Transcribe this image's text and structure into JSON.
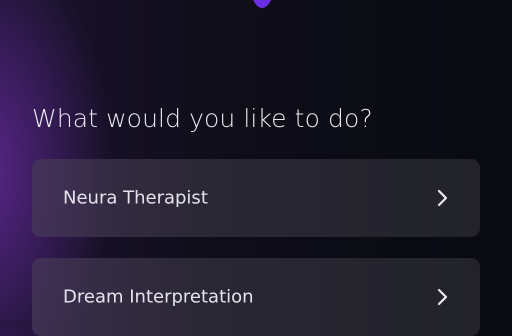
{
  "logo": {
    "icon": "app-logo-icon",
    "color": "#6a2fe0"
  },
  "prompt": {
    "title": "What would you like to do?"
  },
  "options": [
    {
      "label": "Neura Therapist",
      "icon": "chevron-right-icon"
    },
    {
      "label": "Dream Interpretation",
      "icon": "chevron-right-icon"
    }
  ],
  "colors": {
    "background": "#090a12",
    "accent_glow": "#6e2daa",
    "card": "#34323e",
    "text": "#e6e3ec"
  }
}
